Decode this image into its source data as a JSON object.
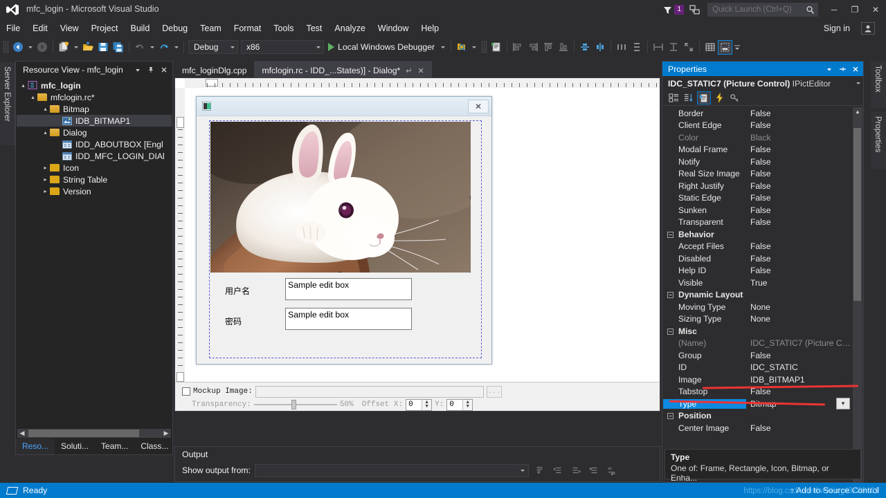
{
  "window": {
    "title": "mfc_login - Microsoft Visual Studio",
    "logo_icon": "visual-studio-logo",
    "minimize": "─",
    "maximize": "❐",
    "close": "✕"
  },
  "menu": {
    "items": [
      "File",
      "Edit",
      "View",
      "Project",
      "Build",
      "Debug",
      "Team",
      "Format",
      "Tools",
      "Test",
      "Analyze",
      "Window",
      "Help"
    ],
    "sign_in": "Sign in",
    "account_icon": "user-account-icon"
  },
  "notifications": {
    "flag_icon": "notification-flag-icon",
    "count": "1",
    "feedback_icon": "feedback-icon"
  },
  "quick_launch": {
    "placeholder": "Quick Launch (Ctrl+Q)",
    "value": "",
    "search_icon": "search-icon"
  },
  "toolbar": {
    "navigate_back": "←",
    "navigate_forward": "→",
    "new_project_icon": "new-project-icon",
    "open_file_icon": "open-folder-icon",
    "save_icon": "save-icon",
    "save_all_icon": "save-all-icon",
    "undo_icon": "undo-icon",
    "redo_icon": "redo-icon",
    "configuration": "Debug",
    "platform": "x86",
    "run_label": "Local Windows Debugger",
    "run_icon": "play-icon",
    "find_icon": "find-in-files-icon",
    "props_window_icon": "properties-window-icon",
    "align_icons": [
      "align-lefts-icon",
      "align-rights-icon",
      "align-tops-icon",
      "align-bottoms-icon",
      "center-vertical-icon",
      "center-horizontal-icon",
      "space-across-icon",
      "space-down-icon",
      "make-same-width-icon",
      "make-same-height-icon",
      "size-to-content-icon",
      "toggle-grid-icon",
      "test-dialog-icon"
    ]
  },
  "left_dock": {
    "tabs": [
      "Server Explorer"
    ]
  },
  "right_dock": {
    "tabs": [
      "Toolbox",
      "Properties"
    ]
  },
  "resource_view": {
    "title": "Resource View - mfc_login",
    "dropdown_icon": "chevron-down-icon",
    "pin_icon": "pin-icon",
    "close_icon": "close-icon",
    "tree": [
      {
        "label": "mfc_login",
        "icon": "solution-icon",
        "depth": 0,
        "twisty": "▴",
        "bold": true,
        "selected": false
      },
      {
        "label": "mfclogin.rc*",
        "icon": "folder-open-icon",
        "depth": 1,
        "twisty": "▴",
        "bold": false,
        "selected": false
      },
      {
        "label": "Bitmap",
        "icon": "folder-open-icon",
        "depth": 2,
        "twisty": "▴",
        "bold": false,
        "selected": false
      },
      {
        "label": "IDB_BITMAP1",
        "icon": "bitmap-resource-icon",
        "depth": 3,
        "twisty": "",
        "bold": false,
        "selected": true
      },
      {
        "label": "Dialog",
        "icon": "folder-open-icon",
        "depth": 2,
        "twisty": "▴",
        "bold": false,
        "selected": false
      },
      {
        "label": "IDD_ABOUTBOX [Engl",
        "icon": "dialog-resource-icon",
        "depth": 3,
        "twisty": "",
        "bold": false,
        "selected": false
      },
      {
        "label": "IDD_MFC_LOGIN_DIAl",
        "icon": "dialog-resource-icon",
        "depth": 3,
        "twisty": "",
        "bold": false,
        "selected": false
      },
      {
        "label": "Icon",
        "icon": "folder-closed-icon",
        "depth": 2,
        "twisty": "▸",
        "bold": false,
        "selected": false
      },
      {
        "label": "String Table",
        "icon": "folder-closed-icon",
        "depth": 2,
        "twisty": "▸",
        "bold": false,
        "selected": false
      },
      {
        "label": "Version",
        "icon": "folder-closed-icon",
        "depth": 2,
        "twisty": "▸",
        "bold": false,
        "selected": false
      }
    ],
    "bottom_tabs": [
      {
        "label": "Reso...",
        "active": true
      },
      {
        "label": "Soluti...",
        "active": false
      },
      {
        "label": "Team...",
        "active": false
      },
      {
        "label": "Class...",
        "active": false
      }
    ]
  },
  "editor": {
    "tabs": [
      {
        "label": "mfc_loginDlg.cpp",
        "active": false,
        "pin": "",
        "close": ""
      },
      {
        "label": "mfclogin.rc - IDD_...States)] - Dialog*",
        "active": true,
        "pin": "↵",
        "close": "✕"
      }
    ],
    "dialog": {
      "icon": "dialog-app-icon",
      "close_label": "✕",
      "picture_control": {
        "image_alt": "white-rabbit-photo",
        "name": "IDC_STATIC7"
      },
      "fields": [
        {
          "label": "用户名",
          "value": "Sample edit box"
        },
        {
          "label": "密码",
          "value": "Sample edit box"
        }
      ]
    },
    "mockup": {
      "checkbox_label": "Mockup Image:",
      "checked": false,
      "path_value": "",
      "browse_label": "...",
      "transparency_label": "Transparency:",
      "transparency_value": "50%",
      "offset_x_label": "Offset X:",
      "offset_x_value": "0",
      "offset_y_label": "Y:",
      "offset_y_value": "0"
    }
  },
  "output": {
    "title": "Output",
    "show_from_label": "Show output from:",
    "show_from_value": "",
    "toolbar_icons": [
      "go-to-message-icon",
      "previous-message-icon",
      "next-message-icon",
      "clear-all-icon",
      "toggle-word-wrap-icon"
    ]
  },
  "properties": {
    "title": "Properties",
    "dropdown_icon": "chevron-down-icon",
    "unpin_icon": "unpin-icon",
    "close_icon": "close-icon",
    "object_name": "IDC_STATIC7 (Picture Control)",
    "object_type": "IPictEditor",
    "object_caret": "chevron-down-icon",
    "tool_icons": [
      {
        "name": "categorized-view-icon",
        "selected": false
      },
      {
        "name": "alphabetical-view-icon",
        "selected": false
      },
      {
        "name": "properties-page-icon",
        "selected": true
      },
      {
        "name": "events-icon",
        "selected": false
      },
      {
        "name": "property-pages-key-icon",
        "selected": false
      }
    ],
    "rows": [
      {
        "name": "Border",
        "value": "False",
        "kind": "prop",
        "dim": false
      },
      {
        "name": "Client Edge",
        "value": "False",
        "kind": "prop",
        "dim": false
      },
      {
        "name": "Color",
        "value": "Black",
        "kind": "prop",
        "dim": true
      },
      {
        "name": "Modal Frame",
        "value": "False",
        "kind": "prop",
        "dim": false
      },
      {
        "name": "Notify",
        "value": "False",
        "kind": "prop",
        "dim": false
      },
      {
        "name": "Real Size Image",
        "value": "False",
        "kind": "prop",
        "dim": false
      },
      {
        "name": "Right Justify",
        "value": "False",
        "kind": "prop",
        "dim": false
      },
      {
        "name": "Static Edge",
        "value": "False",
        "kind": "prop",
        "dim": false
      },
      {
        "name": "Sunken",
        "value": "False",
        "kind": "prop",
        "dim": false
      },
      {
        "name": "Transparent",
        "value": "False",
        "kind": "prop",
        "dim": false
      },
      {
        "name": "Behavior",
        "value": "",
        "kind": "category",
        "dim": false
      },
      {
        "name": "Accept Files",
        "value": "False",
        "kind": "prop",
        "dim": false
      },
      {
        "name": "Disabled",
        "value": "False",
        "kind": "prop",
        "dim": false
      },
      {
        "name": "Help ID",
        "value": "False",
        "kind": "prop",
        "dim": false
      },
      {
        "name": "Visible",
        "value": "True",
        "kind": "prop",
        "dim": false
      },
      {
        "name": "Dynamic Layout",
        "value": "",
        "kind": "category",
        "dim": false
      },
      {
        "name": "Moving Type",
        "value": "None",
        "kind": "prop",
        "dim": false
      },
      {
        "name": "Sizing Type",
        "value": "None",
        "kind": "prop",
        "dim": false
      },
      {
        "name": "Misc",
        "value": "",
        "kind": "category",
        "dim": false
      },
      {
        "name": "(Name)",
        "value": "IDC_STATIC7 (Picture C…",
        "kind": "prop",
        "dim": true
      },
      {
        "name": "Group",
        "value": "False",
        "kind": "prop",
        "dim": false
      },
      {
        "name": "ID",
        "value": "IDC_STATIC",
        "kind": "prop",
        "dim": false
      },
      {
        "name": "Image",
        "value": "IDB_BITMAP1",
        "kind": "prop",
        "dim": false
      },
      {
        "name": "Tabstop",
        "value": "False",
        "kind": "prop",
        "dim": false
      },
      {
        "name": "Type",
        "value": "Bitmap",
        "kind": "prop",
        "dim": false,
        "selected": true,
        "dropdown": true
      },
      {
        "name": "Position",
        "value": "",
        "kind": "category",
        "dim": false
      },
      {
        "name": "Center Image",
        "value": "False",
        "kind": "prop",
        "dim": false
      }
    ],
    "description": {
      "title": "Type",
      "text": "One of: Frame, Rectangle, Icon, Bitmap, or Enha..."
    }
  },
  "status_bar": {
    "icon": "ready-icon",
    "text": "Ready",
    "source_control": "↑ Add to Source Control",
    "watermark": "https://blog.csdn.net/weixin_43189421"
  },
  "colors": {
    "accent": "#007acc",
    "chrome": "#2d2d30",
    "panel": "#252526",
    "badge_purple": "#68217a",
    "selection_blue": "#0d89e0",
    "annotation_red": "#ee3333"
  }
}
